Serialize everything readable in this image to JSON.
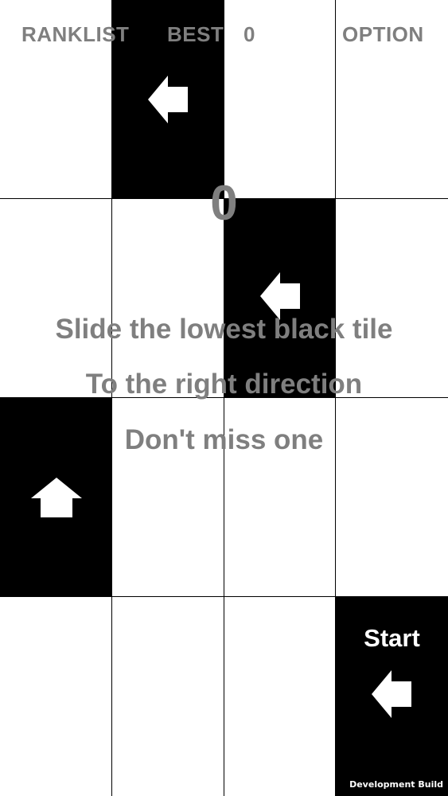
{
  "header": {
    "ranklist_label": "RANKLIST",
    "best_label": "BEST",
    "best_value": "0",
    "option_label": "OPTION"
  },
  "score": "0",
  "instructions": {
    "line1": "Slide the lowest black tile",
    "line2": "To the right direction",
    "line3": "Don't miss one"
  },
  "start_label": "Start",
  "dev_build_label": "Development Build",
  "board": {
    "rows": [
      {
        "black_col": 1,
        "arrow": "left"
      },
      {
        "black_col": 2,
        "arrow": "left"
      },
      {
        "black_col": 0,
        "arrow": "up"
      },
      {
        "black_col": 3,
        "arrow": "left"
      }
    ]
  },
  "colors": {
    "tile_black": "#000000",
    "tile_white": "#ffffff",
    "text_gray": "#7f7f7f",
    "arrow": "#ffffff"
  }
}
